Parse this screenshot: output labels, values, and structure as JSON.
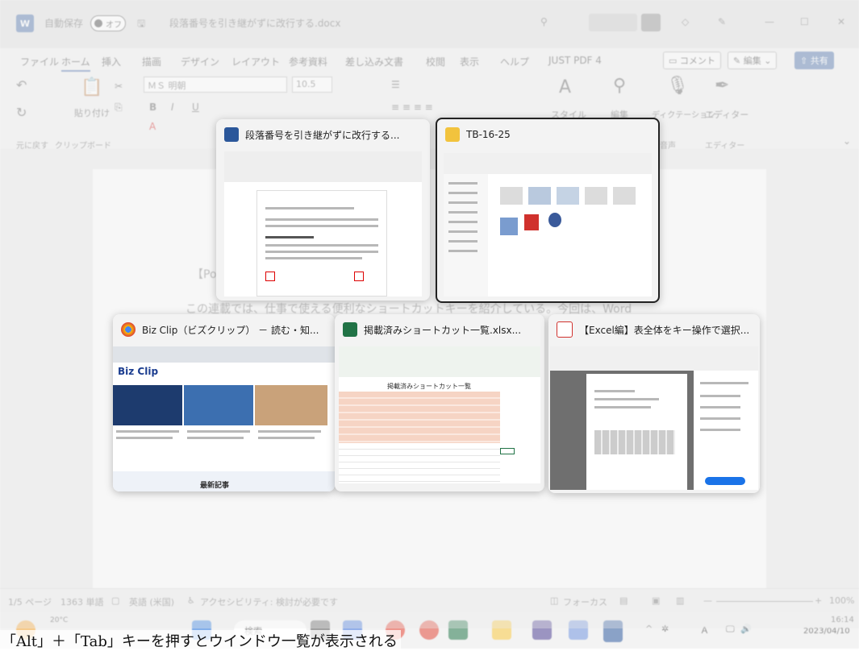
{
  "window": {
    "autosave_label": "自動保存",
    "autosave_state": "オフ",
    "doc_title": "段落番号を引き継がずに改行する.docx",
    "menus": [
      "ファイル",
      "ホーム",
      "挿入",
      "描画",
      "デザイン",
      "レイアウト",
      "参考資料",
      "差し込み文書",
      "校閲",
      "表示",
      "ヘルプ",
      "JUST PDF 4"
    ],
    "comment_btn": "コメント",
    "edit_btn": "編集",
    "share_btn": "共有"
  },
  "ribbon": {
    "font_name": "ＭＳ 明朝",
    "font_size": "10.5",
    "paste": "貼り付け",
    "style": "スタイル",
    "edit": "編集",
    "dictate": "ディクテーション",
    "editor": "エディター",
    "groups": {
      "undo": "元に戻す",
      "clipboard": "クリップボード",
      "voice": "音声",
      "editor": "エディター"
    }
  },
  "doc": {
    "line1": "【Po",
    "line2": "この連載では、仕事で使える便利なショートカットキーを紹介している。今回は、Word"
  },
  "status": {
    "page": "1/5 ページ",
    "words": "1363 単語",
    "lang": "英語 (米国)",
    "access": "アクセシビリティ: 検討が必要です",
    "focus": "フォーカス",
    "zoom": "100%"
  },
  "taskbar": {
    "temp": "20°C",
    "search": "検索",
    "time": "16:14",
    "date": "2023/04/10"
  },
  "switcher": {
    "windows": [
      {
        "title": "段落番号を引き継がずに改行する...",
        "app": "word"
      },
      {
        "title": "TB-16-25",
        "app": "explorer"
      },
      {
        "title": "Biz Clip（ビズクリップ） － 読む・知...",
        "app": "chrome"
      },
      {
        "title": "掲載済みショートカット一覧.xlsx...",
        "app": "excel"
      },
      {
        "title": "【Excel編】表全体をキー操作で選択...",
        "app": "pdf"
      }
    ],
    "bizclip_logo": "Biz Clip",
    "bizclip_footer": "最新記事",
    "excel_thumb_title": "掲載済みショートカット一覧"
  },
  "caption": "「Alt」＋「Tab」キーを押すとウインドウ一覧が表示される",
  "colors": {
    "word": "#2b579a",
    "excel": "#217346",
    "folder": "#f2c33d",
    "chrome_red": "#db4437",
    "pdf": "#d0312d"
  }
}
